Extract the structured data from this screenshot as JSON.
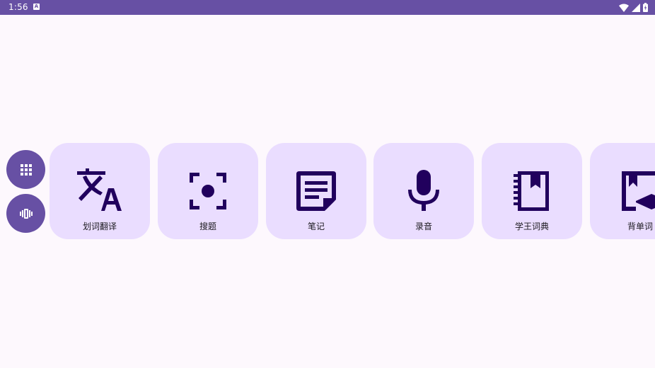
{
  "status_bar": {
    "time": "1:56",
    "notification_icon": "a-box-icon",
    "notification_glyph": "A",
    "right_icons": [
      "wifi-icon",
      "cell-signal-icon",
      "battery-charging-icon"
    ],
    "background": "#6750a4"
  },
  "side_buttons": [
    {
      "name": "apps-grid-button",
      "icon": "grid-icon"
    },
    {
      "name": "vibrate-button",
      "icon": "vibrate-icon"
    }
  ],
  "tiles": [
    {
      "label": "划词翻译",
      "icon": "translate-icon"
    },
    {
      "label": "搜题",
      "icon": "center-focus-icon"
    },
    {
      "label": "笔记",
      "icon": "note-icon"
    },
    {
      "label": "录音",
      "icon": "microphone-icon"
    },
    {
      "label": "学王词典",
      "icon": "dictionary-icon"
    },
    {
      "label": "背单词",
      "icon": "bookmark-learn-icon"
    }
  ],
  "colors": {
    "accent": "#6750a4",
    "tile_background": "#eaddff",
    "icon_color": "#21005d",
    "page_background": "#fdf8fd"
  }
}
